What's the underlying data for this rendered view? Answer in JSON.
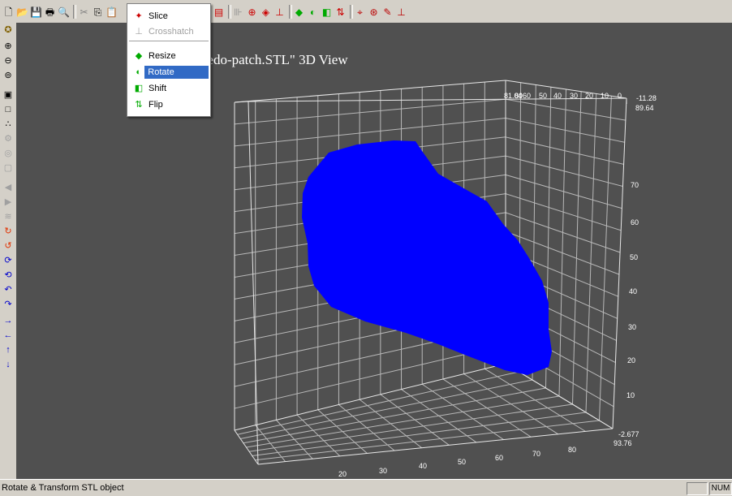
{
  "toolbar": {
    "icons": [
      "new-file-icon",
      "open-folder-icon",
      "save-icon",
      "print-icon",
      "print-preview-icon",
      "cut-icon",
      "copy-icon",
      "paste-icon",
      "slice-icon",
      "crosshatch-icon",
      "resize-icon",
      "rotate-icon",
      "shift-icon",
      "flip-icon",
      "grid-icon",
      "toolpath-icon",
      "layer-icon",
      "view-icon"
    ]
  },
  "menu": {
    "items": [
      {
        "label": "Slice",
        "icon": "slice-icon",
        "enabled": true
      },
      {
        "label": "Crosshatch",
        "icon": "crosshatch-icon",
        "enabled": false
      },
      {
        "label": "Resize",
        "icon": "resize-icon",
        "enabled": true
      },
      {
        "label": "Rotate",
        "icon": "rotate-icon",
        "enabled": true,
        "selected": true
      },
      {
        "label": "Shift",
        "icon": "shift-icon",
        "enabled": true
      },
      {
        "label": "Flip",
        "icon": "flip-icon",
        "enabled": true
      }
    ]
  },
  "view": {
    "title": "e \"redo-patch.STL\" 3D View",
    "background": "#505050",
    "object_color": "#0000ff",
    "top_axis": {
      "ticks": [
        "81.04",
        "80",
        "60",
        "50",
        "40",
        "30",
        "20",
        "10",
        "0"
      ],
      "corner_top": "-11.28",
      "corner_bottom": "89.64"
    },
    "right_axis": {
      "ticks": [
        "70",
        "60",
        "50",
        "40",
        "30",
        "20",
        "10"
      ],
      "corner_top": "-2.677",
      "corner_bottom": "93.76"
    },
    "bottom_axis": {
      "ticks": [
        "20",
        "30",
        "40",
        "50",
        "60",
        "70",
        "80"
      ]
    }
  },
  "status": {
    "text": "Rotate & Transform STL object",
    "num": "NUM"
  }
}
